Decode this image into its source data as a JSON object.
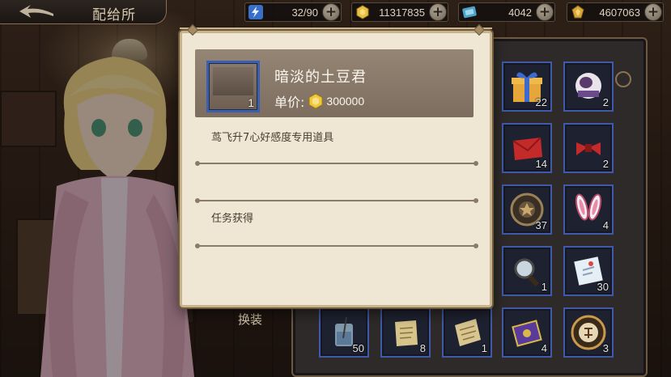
{
  "header": {
    "title": "配给所",
    "resources": [
      {
        "icon": "lightning-icon",
        "value": "32/90"
      },
      {
        "icon": "gold-coin-icon",
        "value": "11317835"
      },
      {
        "icon": "blue-gem-icon",
        "value": "4042"
      },
      {
        "icon": "gold-medal-icon",
        "value": "4607063"
      }
    ]
  },
  "popup": {
    "item_name": "暗淡的土豆君",
    "item_count": "1",
    "price_label": "单价:",
    "price_value": "300000",
    "description": "茑飞升7心好感度专用道具",
    "source": "任务获得"
  },
  "inventory": {
    "change_label": "换装",
    "slots": [
      {
        "icon": "gift-box-icon",
        "count": "22"
      },
      {
        "icon": "costume-item-icon",
        "count": "2"
      },
      {
        "icon": "red-envelope-icon",
        "count": "14"
      },
      {
        "icon": "red-ribbon-icon",
        "count": "2"
      },
      {
        "icon": "bronze-medal-icon",
        "count": "37"
      },
      {
        "icon": "bunny-ears-icon",
        "count": "4"
      },
      {
        "icon": "magnifier-icon",
        "count": "1"
      },
      {
        "icon": "letter-icon",
        "count": "30"
      },
      {
        "icon": "drink-glass-icon",
        "count": "50"
      },
      {
        "icon": "scroll-icon",
        "count": "8"
      },
      {
        "icon": "document-icon",
        "count": "1"
      },
      {
        "icon": "purple-card-icon",
        "count": "4"
      },
      {
        "icon": "princess-seal-icon",
        "count": "3"
      }
    ]
  },
  "colors": {
    "slot_border": "#3e5aa8",
    "popup_bg": "#efe6d4",
    "header_band": "#8a7a6b"
  }
}
